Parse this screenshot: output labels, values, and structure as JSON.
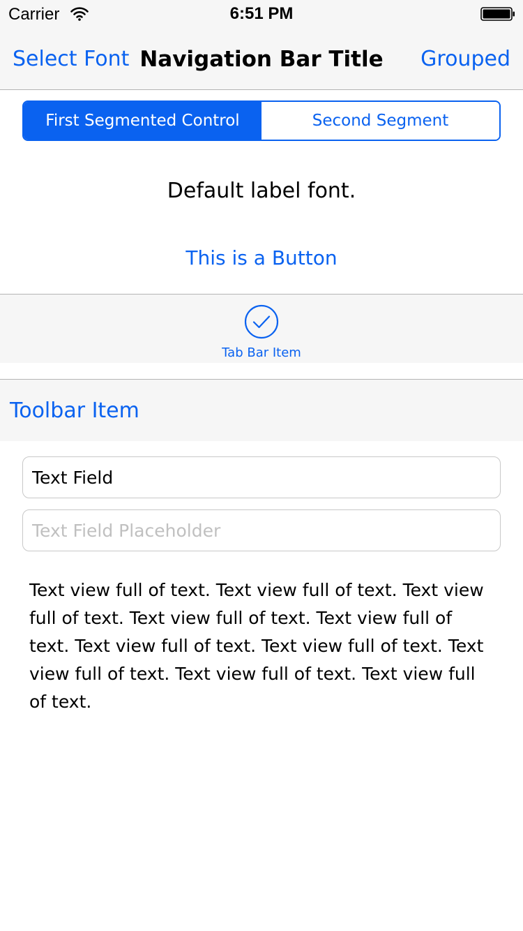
{
  "status_bar": {
    "carrier": "Carrier",
    "time": "6:51 PM",
    "wifi_icon": "wifi-icon",
    "battery_icon": "battery-icon"
  },
  "nav_bar": {
    "left_button": "Select Font",
    "title": "Navigation Bar Title",
    "right_button": "Grouped"
  },
  "segmented_control": {
    "segments": [
      "First Segmented Control",
      "Second Segment"
    ],
    "selected_index": 0
  },
  "label": {
    "text": "Default label font."
  },
  "button": {
    "label": "This is a Button"
  },
  "tab_bar": {
    "items": [
      {
        "label": "Tab Bar Item",
        "icon": "checkmark-circle-icon",
        "selected": true
      }
    ]
  },
  "toolbar": {
    "item_label": "Toolbar Item"
  },
  "text_fields": {
    "field1": {
      "value": "Text Field",
      "placeholder": ""
    },
    "field2": {
      "value": "",
      "placeholder": "Text Field Placeholder"
    }
  },
  "text_view": {
    "text": "Text view full of text. Text view full of text. Text view full of text. Text view full of text. Text view full of text. Text view full of text. Text view full of text. Text view full of text. Text view full of text. Text view full of text."
  },
  "colors": {
    "tint": "#0a62f0",
    "bar_background": "#f6f6f6",
    "separator": "#b4b4b4",
    "placeholder": "#c0c0c0"
  }
}
